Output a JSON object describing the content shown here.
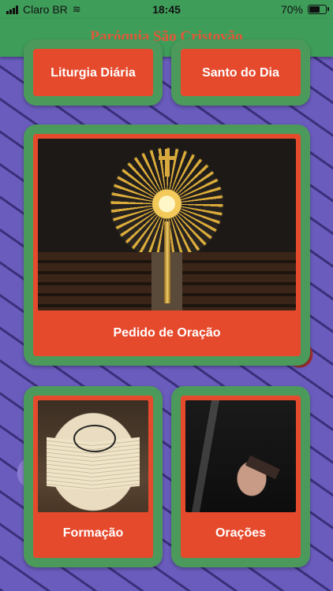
{
  "status_bar": {
    "carrier": "Claro BR",
    "time": "18:45",
    "battery": "70%",
    "battery_level": 0.7
  },
  "header": {
    "title": "Paróquia São Cristovão"
  },
  "cards": {
    "liturgia": {
      "label": "Liturgia Diária"
    },
    "santo": {
      "label": "Santo do Dia"
    },
    "pedido": {
      "label": "Pedido de Oração"
    },
    "formacao": {
      "label": "Formação"
    },
    "oracoes": {
      "label": "Orações"
    }
  },
  "colors": {
    "header_green": "#3f9d5a",
    "card_frame": "#4b9a5b",
    "card_fill": "#e64a2d",
    "title_text": "#e2583a"
  }
}
